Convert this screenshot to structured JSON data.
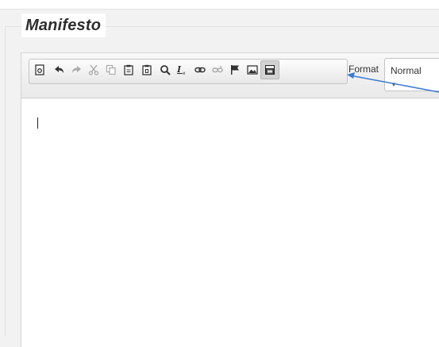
{
  "page": {
    "title": "Manifesto"
  },
  "toolbar": {
    "buttons": [
      {
        "icon": "source-icon",
        "label": "Source"
      },
      {
        "icon": "undo-icon",
        "label": "Undo"
      },
      {
        "icon": "redo-icon",
        "label": "Redo"
      },
      {
        "icon": "cut-icon",
        "label": "Cut"
      },
      {
        "icon": "copy-icon",
        "label": "Copy"
      },
      {
        "icon": "paste-icon",
        "label": "Paste"
      },
      {
        "icon": "paste-text-icon",
        "label": "Paste as plain text"
      },
      {
        "icon": "find-icon",
        "label": "Find"
      },
      {
        "icon": "remove-format-icon",
        "label": "Remove Format"
      },
      {
        "icon": "link-icon",
        "label": "Link"
      },
      {
        "icon": "unlink-icon",
        "label": "Unlink"
      },
      {
        "icon": "anchor-flag-icon",
        "label": "Anchor"
      },
      {
        "icon": "image-icon",
        "label": "Image"
      },
      {
        "icon": "youtube-embed-icon",
        "label": "Embed",
        "active": true
      }
    ],
    "format_label": "Format",
    "format_value": "Normal"
  },
  "colors": {
    "annotation_arrow": "#3a7bd5",
    "toolbar_bg": "#eeeeee"
  }
}
